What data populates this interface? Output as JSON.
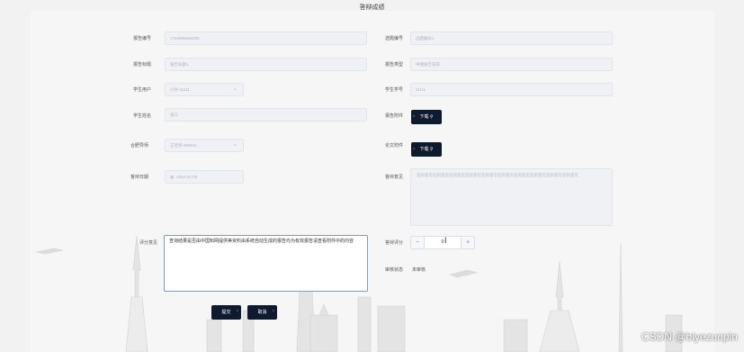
{
  "page": {
    "title": "答辩成绩"
  },
  "form": {
    "left": {
      "report_no": {
        "label": "报告编号",
        "value": "1764980568298"
      },
      "report_title": {
        "label": "报告标题",
        "placeholder": "报告标题1"
      },
      "student_user": {
        "label": "学生用户",
        "value": "小孙-11111"
      },
      "student_name": {
        "label": "学生姓名",
        "value": "张三"
      },
      "advisor_no": {
        "label": "合肥导师",
        "value": "王老师-999911"
      },
      "defense_date": {
        "label": "答辩日期",
        "value": "2024-01-08"
      },
      "review": {
        "label": "评分意见",
        "value": "查询结果是否由中国知网提供等资料由系统自动生成的报告均为有效报告请查看附件中的内容"
      }
    },
    "right": {
      "topic_no": {
        "label": "选题编号",
        "value": "选题编号1"
      },
      "report_type": {
        "label": "报告类型",
        "value": "中期报告答辩"
      },
      "student_id": {
        "label": "学生学号",
        "value": "11111"
      },
      "report_file": {
        "label": "报告附件",
        "button": "下载"
      },
      "thesis_file": {
        "label": "论文附件",
        "button": "下载"
      },
      "defense_note": {
        "label": "答辩意见",
        "value": "答辩意见答辩意见答辩意见答辩意见答辩意见答辩意见答辩意见答辩意见答辩意见答辩意见"
      },
      "defense_score": {
        "label": "答辩评分",
        "value": "0",
        "minus": "−",
        "plus": "+"
      },
      "audit_status": {
        "label": "审核状态",
        "value": "未审核"
      }
    }
  },
  "actions": {
    "submit": "提交",
    "cancel": "取消"
  },
  "watermark": "CSDN @biyezuopin"
}
